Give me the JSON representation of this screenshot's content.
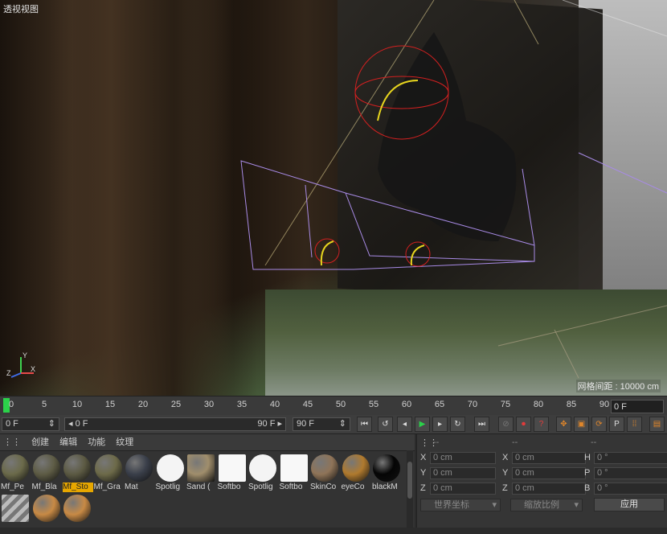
{
  "viewport": {
    "title": "透视视图",
    "grid_spacing": "网格间距 : 10000 cm",
    "axis_labels": {
      "x": "X",
      "y": "Y",
      "z": "Z"
    }
  },
  "timeline": {
    "ticks": [
      "0",
      "5",
      "10",
      "15",
      "20",
      "25",
      "30",
      "35",
      "40",
      "45",
      "50",
      "55",
      "60",
      "65",
      "70",
      "75",
      "80",
      "85",
      "90"
    ],
    "current_frame": "0 F"
  },
  "transport": {
    "start_frame": "0 F",
    "range_start": "0 F",
    "range_end": "90 F",
    "end_frame": "90 F",
    "buttons": [
      "go-to-start",
      "prev-key",
      "play-back",
      "play-forward",
      "next-frame",
      "next-key",
      "go-to-end"
    ],
    "colors": {
      "play": "#2bd24a",
      "record": "#e23b3b",
      "active": "#e0862a"
    }
  },
  "material_panel": {
    "menu": [
      "创建",
      "编辑",
      "功能",
      "纹理"
    ],
    "materials": [
      {
        "name": "Mf_Pe",
        "color": "#6b6a4a"
      },
      {
        "name": "Mf_Bla",
        "color": "#5e5c45"
      },
      {
        "name": "Mf_Sto",
        "color": "#5c5a43",
        "selected": true
      },
      {
        "name": "Mf_Gra",
        "color": "#6d6a49"
      },
      {
        "name": "Mat",
        "color": "#3a3f4a"
      },
      {
        "name": "Spotlig",
        "color": "#f4f4f4"
      },
      {
        "name": "Sand (",
        "color": "#a08e6c"
      },
      {
        "name": "Softbo",
        "color": "#f8f8f8"
      },
      {
        "name": "Spotlig",
        "color": "#f4f4f4"
      },
      {
        "name": "Softbo",
        "color": "#f8f8f8"
      },
      {
        "name": "SkinCo",
        "color": "#8f7458"
      },
      {
        "name": "eyeCo",
        "color": "#b07a2e"
      },
      {
        "name": "blackM",
        "color": "#050505"
      },
      {
        "name": "",
        "color": "#9a9a9a"
      },
      {
        "name": "",
        "color": "#c88a45"
      },
      {
        "name": "",
        "color": "#c88a45"
      }
    ]
  },
  "coordinates": {
    "headers": [
      "--",
      "--",
      "--"
    ],
    "rows": [
      {
        "a_label": "X",
        "a_value": "0 cm",
        "b_label": "X",
        "b_value": "0 cm",
        "c_label": "H",
        "c_value": "0 °"
      },
      {
        "a_label": "Y",
        "a_value": "0 cm",
        "b_label": "Y",
        "b_value": "0 cm",
        "c_label": "P",
        "c_value": "0 °"
      },
      {
        "a_label": "Z",
        "a_value": "0 cm",
        "b_label": "Z",
        "b_value": "0 cm",
        "c_label": "B",
        "c_value": "0 °"
      }
    ],
    "coord_system": "世界坐标",
    "scale_mode": "缩放比例",
    "apply_label": "应用"
  }
}
